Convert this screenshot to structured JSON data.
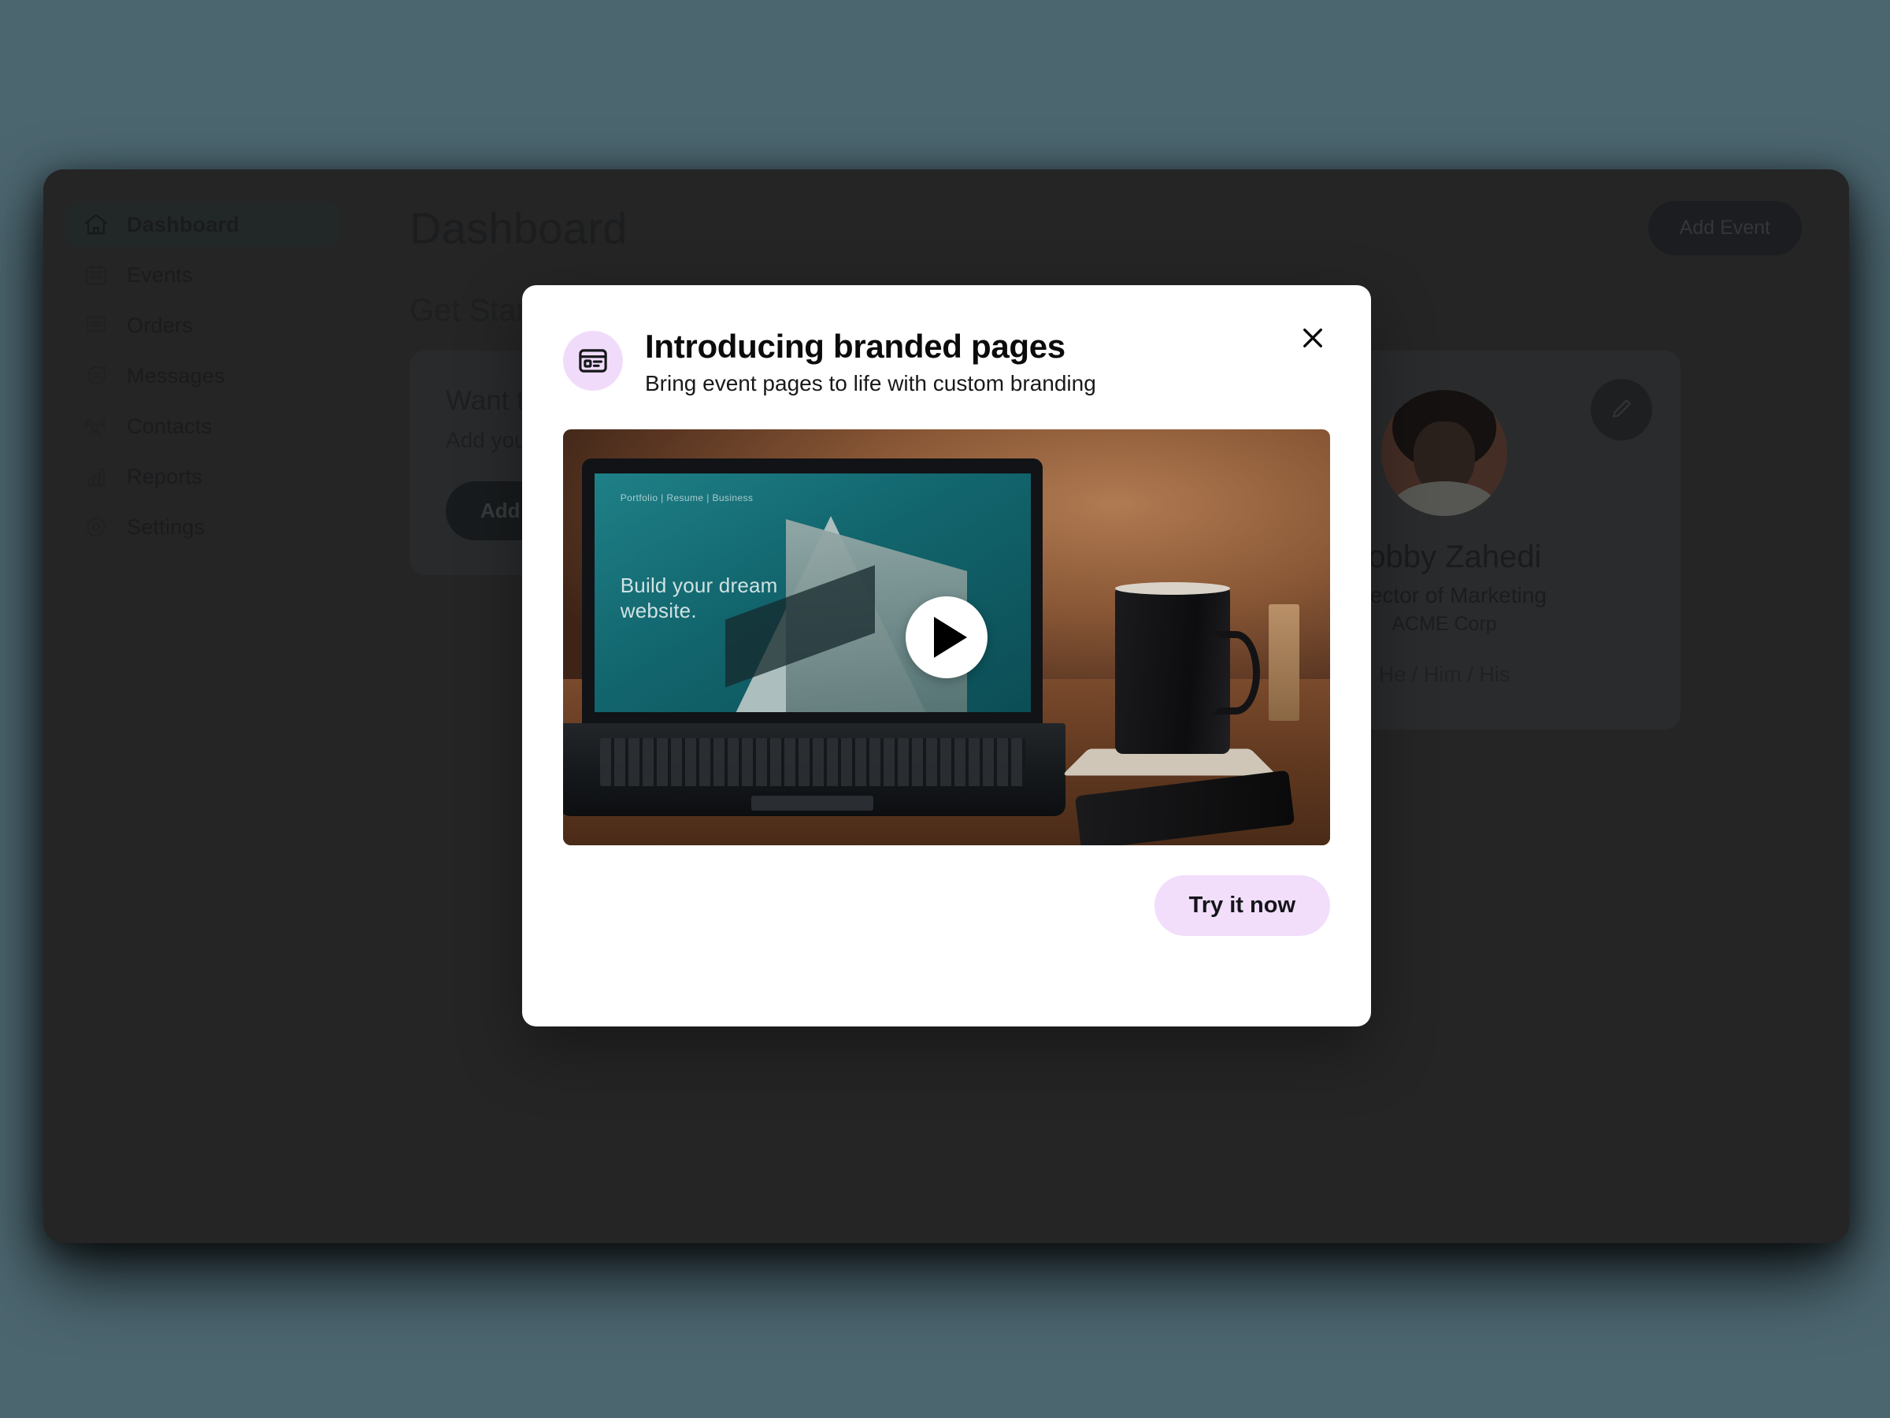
{
  "theme": {
    "page_background": "#4c6670",
    "app_background": "#333333",
    "modal_background": "#ffffff",
    "accent_lavender": "#f0dcfa",
    "cta_background": "#f2ddfb"
  },
  "sidebar": {
    "items": [
      {
        "label": "Dashboard",
        "icon": "home-icon",
        "active": true
      },
      {
        "label": "Events",
        "icon": "calendar-icon",
        "active": false
      },
      {
        "label": "Orders",
        "icon": "receipt-icon",
        "active": false
      },
      {
        "label": "Messages",
        "icon": "chat-icon",
        "active": false
      },
      {
        "label": "Contacts",
        "icon": "people-icon",
        "active": false
      },
      {
        "label": "Reports",
        "icon": "bar-chart-icon",
        "active": false
      },
      {
        "label": "Settings",
        "icon": "gear-icon",
        "active": false
      }
    ]
  },
  "main": {
    "page_title": "Dashboard",
    "add_event_label": "Add Event",
    "section_title": "Get Started",
    "onboarding_card": {
      "title": "Want to brand your event pages?",
      "subtitle": "Add your organization to get started",
      "button_label": "Add organization"
    },
    "profile_card": {
      "name": "Bobby Zahedi",
      "role": "Director of Marketing",
      "organization": "ACME Corp",
      "pronouns": "He / Him / His",
      "edit_icon": "pencil-icon",
      "avatar_alt": "Bobby Zahedi avatar"
    }
  },
  "modal": {
    "icon": "browser-page-icon",
    "title": "Introducing branded pages",
    "subtitle": "Bring event pages to life with custom branding",
    "close_icon": "close-icon",
    "video": {
      "play_icon": "play-icon",
      "screen_nav": "Portfolio | Resume | Business",
      "screen_headline_line1": "Build your dream",
      "screen_headline_line2": "website."
    },
    "cta_label": "Try it now"
  }
}
